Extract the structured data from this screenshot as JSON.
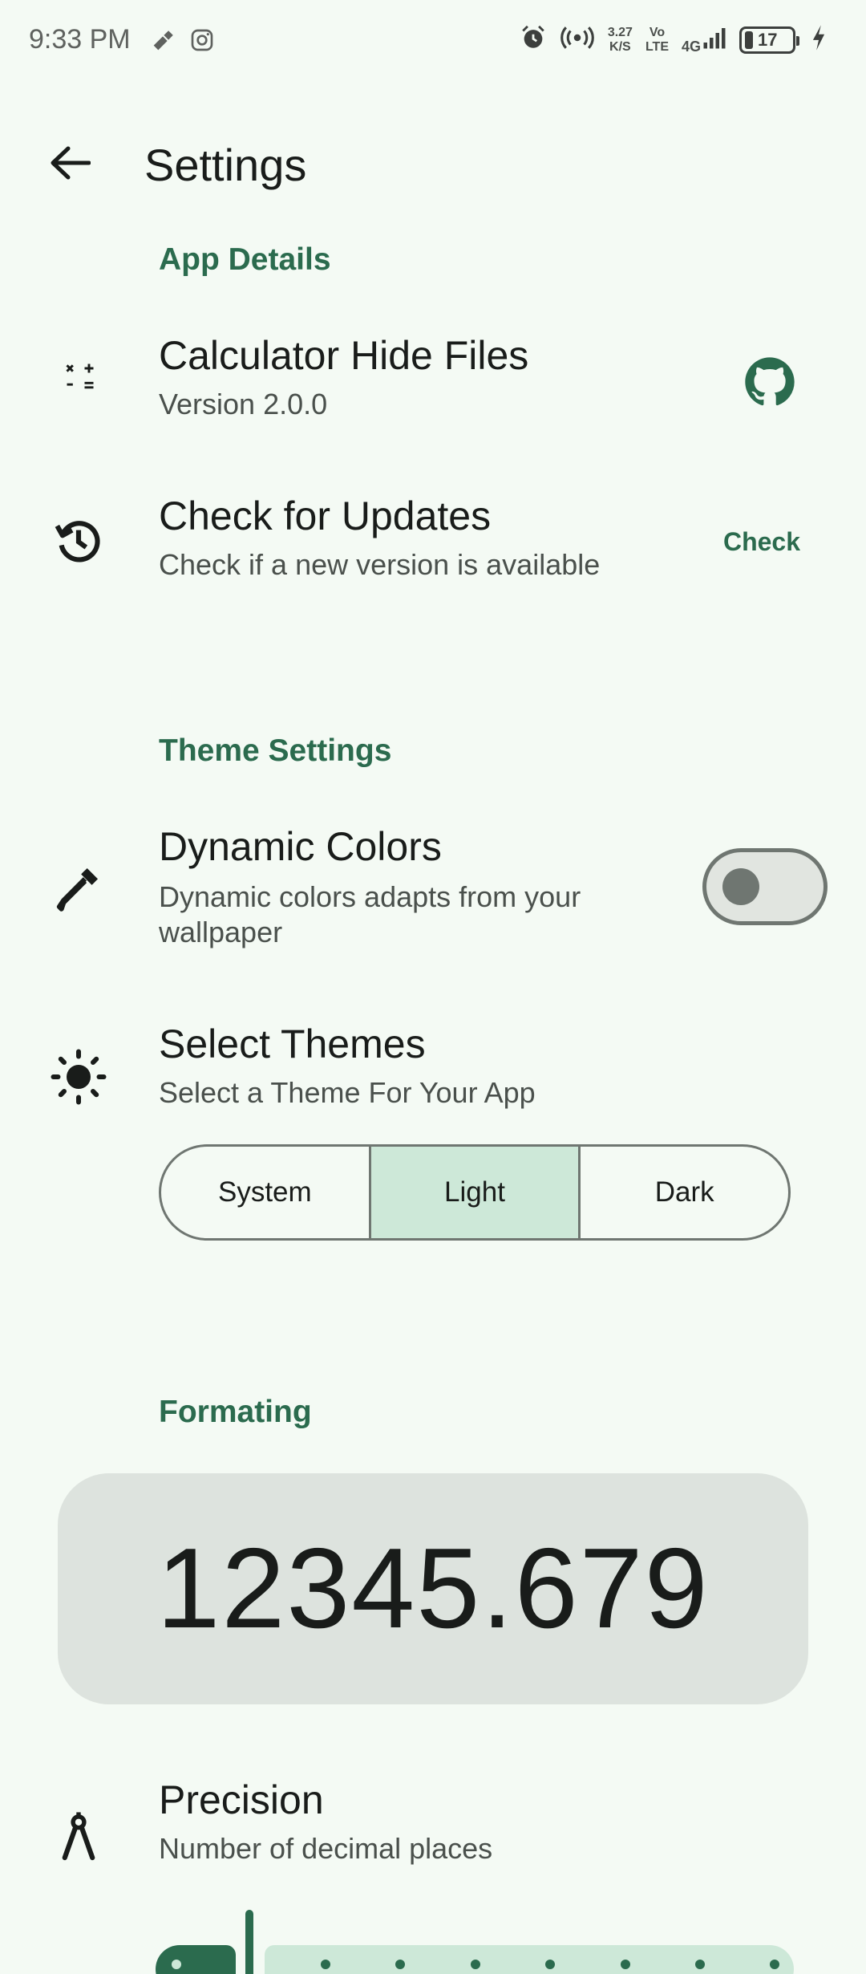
{
  "status_bar": {
    "time": "9:33 PM",
    "speed_value": "3.27",
    "speed_unit": "K/S",
    "volte_top": "Vo",
    "volte_bottom": "LTE",
    "network": "4G",
    "battery": "17",
    "icons": [
      "crossed-tool-icon",
      "instagram-icon",
      "alarm-icon",
      "hotspot-icon",
      "signal-icon",
      "charging-icon"
    ]
  },
  "header": {
    "title": "Settings",
    "back_icon": "arrow-left-icon"
  },
  "app_details": {
    "section_title": "App Details",
    "app_row": {
      "title": "Calculator Hide Files",
      "subtitle": "Version 2.0.0",
      "icon": "calculator-icon",
      "action_icon": "github-icon"
    },
    "updates_row": {
      "title": "Check for Updates",
      "subtitle": "Check if a new version is available",
      "icon": "history-icon",
      "action_label": "Check"
    }
  },
  "theme_settings": {
    "section_title": "Theme Settings",
    "dynamic_colors": {
      "title": "Dynamic Colors",
      "subtitle_line1": "Dynamic colors adapts from your",
      "subtitle_line2": "wallpaper",
      "icon": "eyedropper-icon",
      "enabled": false
    },
    "select_themes": {
      "title": "Select Themes",
      "subtitle": "Select a Theme For Your App",
      "icon": "sun-icon",
      "options": [
        "System",
        "Light",
        "Dark"
      ],
      "selected": "Light"
    }
  },
  "formatting": {
    "section_title": "Formating",
    "preview_value": "12345.679",
    "precision": {
      "title": "Precision",
      "subtitle": "Number of decimal places",
      "icon": "compass-icon",
      "value": 1,
      "steps": 8
    }
  },
  "colors": {
    "accent": "#2b6b4e",
    "accent_container": "#cde8d8",
    "background": "#f4faf4"
  }
}
